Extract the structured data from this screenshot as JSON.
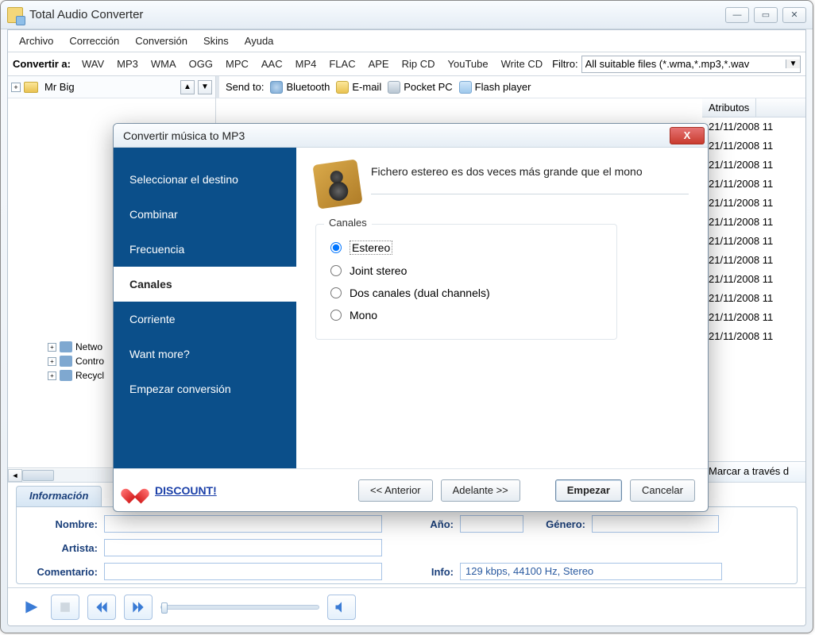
{
  "window": {
    "title": "Total Audio Converter"
  },
  "menu": [
    "Archivo",
    "Corrección",
    "Conversión",
    "Skins",
    "Ayuda"
  ],
  "convertbar": {
    "label": "Convertir a:",
    "formats": [
      "WAV",
      "MP3",
      "WMA",
      "OGG",
      "MPC",
      "AAC",
      "MP4",
      "FLAC",
      "APE",
      "Rip CD",
      "YouTube",
      "Write CD"
    ],
    "filter_label": "Filtro:",
    "filter_value": "All suitable files (*.wma,*.mp3,*.wav"
  },
  "folderbar": {
    "name": "Mr Big"
  },
  "tree": [
    {
      "label": "Netwo"
    },
    {
      "label": "Contro"
    },
    {
      "label": "Recycl"
    }
  ],
  "sendto": {
    "label": "Send to:",
    "items": [
      "Bluetooth",
      "E-mail",
      "Pocket PC",
      "Flash player"
    ]
  },
  "filelist": {
    "column": "Atributos",
    "rows": [
      "21/11/2008 11",
      "21/11/2008 11",
      "21/11/2008 11",
      "21/11/2008 11",
      "21/11/2008 11",
      "21/11/2008 11",
      "21/11/2008 11",
      "21/11/2008 11",
      "21/11/2008 11",
      "21/11/2008 11",
      "21/11/2008 11",
      "21/11/2008 11"
    ],
    "marcar": "Marcar a través d"
  },
  "info": {
    "tab": "Información",
    "nombre_label": "Nombre:",
    "artista_label": "Artista:",
    "comentario_label": "Comentario:",
    "ano_label": "Año:",
    "genero_label": "Género:",
    "info_label": "Info:",
    "info_value": "129 kbps, 44100 Hz, Stereo"
  },
  "dialog": {
    "title": "Convertir música to MP3",
    "steps": [
      "Seleccionar el destino",
      "Combinar",
      "Frecuencia",
      "Canales",
      "Corriente",
      "Want more?",
      "Empezar conversión"
    ],
    "active_step": "Canales",
    "message": "Fichero estereo es dos veces más grande que el mono",
    "group_label": "Canales",
    "options": [
      "Estereo",
      "Joint stereo",
      "Dos canales (dual channels)",
      "Mono"
    ],
    "selected_option": "Estereo",
    "discount": "DISCOUNT!",
    "btn_prev": "<< Anterior",
    "btn_next": "Adelante >>",
    "btn_start": "Empezar",
    "btn_cancel": "Cancelar"
  }
}
